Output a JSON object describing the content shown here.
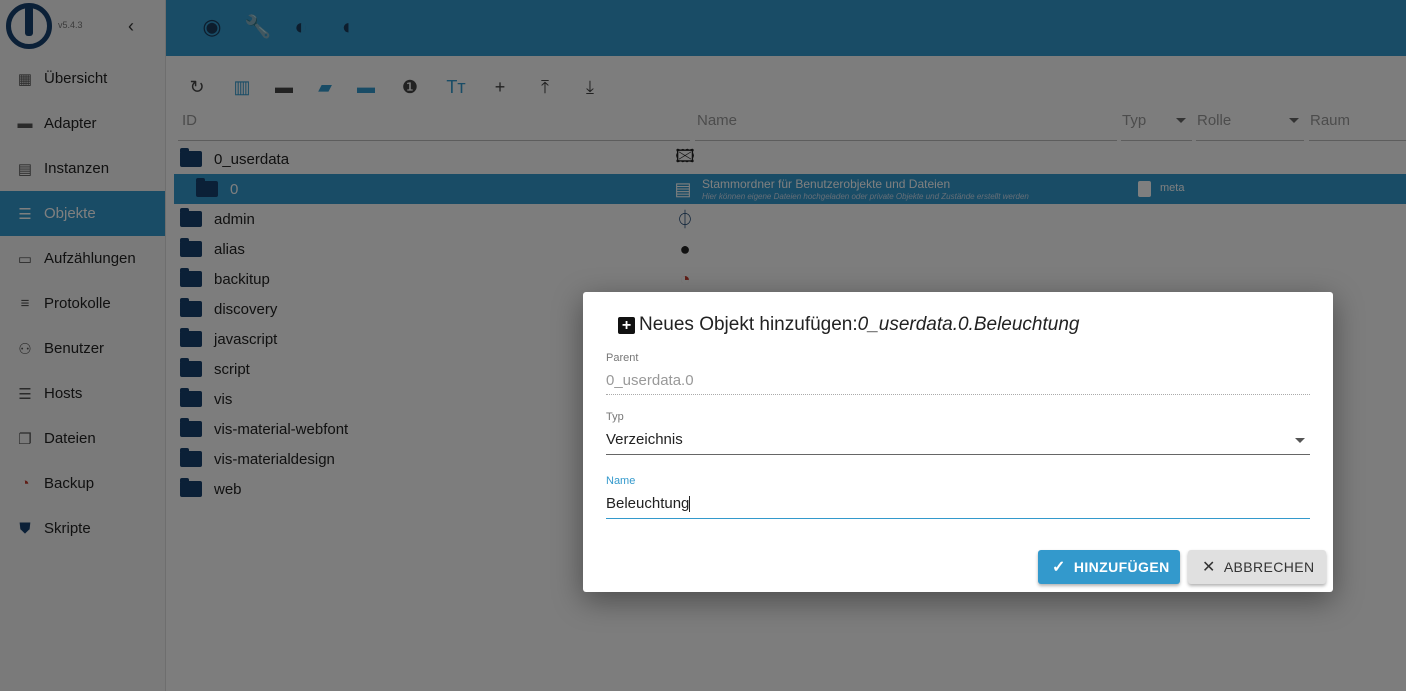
{
  "sidebar": {
    "version": "v5.4.3",
    "collapse_icon": "chevron-left-icon",
    "items": [
      {
        "label": "Übersicht",
        "icon": "grid-icon"
      },
      {
        "label": "Adapter",
        "icon": "store-icon"
      },
      {
        "label": "Instanzen",
        "icon": "instances-icon"
      },
      {
        "label": "Objekte",
        "icon": "list-icon",
        "active": true
      },
      {
        "label": "Aufzählungen",
        "icon": "enum-icon"
      },
      {
        "label": "Protokolle",
        "icon": "log-icon"
      },
      {
        "label": "Benutzer",
        "icon": "user-icon"
      },
      {
        "label": "Hosts",
        "icon": "hosts-icon"
      },
      {
        "label": "Dateien",
        "icon": "files-icon"
      },
      {
        "label": "Backup",
        "icon": "backup-icon"
      },
      {
        "label": "Skripte",
        "icon": "js-icon"
      }
    ]
  },
  "topbar": {
    "icons": [
      "eye-icon",
      "wrench-icon",
      "brightness-icon",
      "head-icon"
    ]
  },
  "toolbar": {
    "icons": [
      "refresh-icon",
      "columns-icon",
      "folder-icon",
      "folder-open-icon",
      "folder-blue-icon",
      "number-one-icon",
      "text-size-icon",
      "add-icon",
      "upload-icon",
      "download-icon"
    ]
  },
  "table": {
    "headers": {
      "id": "ID",
      "name": "Name",
      "type": "Typ",
      "role": "Rolle",
      "room": "Raum"
    },
    "rows": [
      {
        "id": "0_userdata"
      },
      {
        "id": "0",
        "name": "Stammordner für Benutzerobjekte und Dateien",
        "desc": "Hier können eigene Dateien hochgeladen oder private Objekte und Zustände erstellt werden",
        "role": "meta"
      },
      {
        "id": "admin"
      },
      {
        "id": "alias"
      },
      {
        "id": "backitup"
      },
      {
        "id": "discovery"
      },
      {
        "id": "javascript"
      },
      {
        "id": "script"
      },
      {
        "id": "vis"
      },
      {
        "id": "vis-material-webfont"
      },
      {
        "id": "vis-materialdesign"
      },
      {
        "id": "web"
      }
    ]
  },
  "dialog": {
    "title_prefix": "Neues Objekt hinzufügen:",
    "title_path": "0_userdata.0.Beleuchtung",
    "parent_label": "Parent",
    "parent_value": "0_userdata.0",
    "type_label": "Typ",
    "type_value": "Verzeichnis",
    "name_label": "Name",
    "name_value": "Beleuchtung",
    "add_button": "HINZUFÜGEN",
    "cancel_button": "ABBRECHEN",
    "accent": "#3399cc"
  }
}
